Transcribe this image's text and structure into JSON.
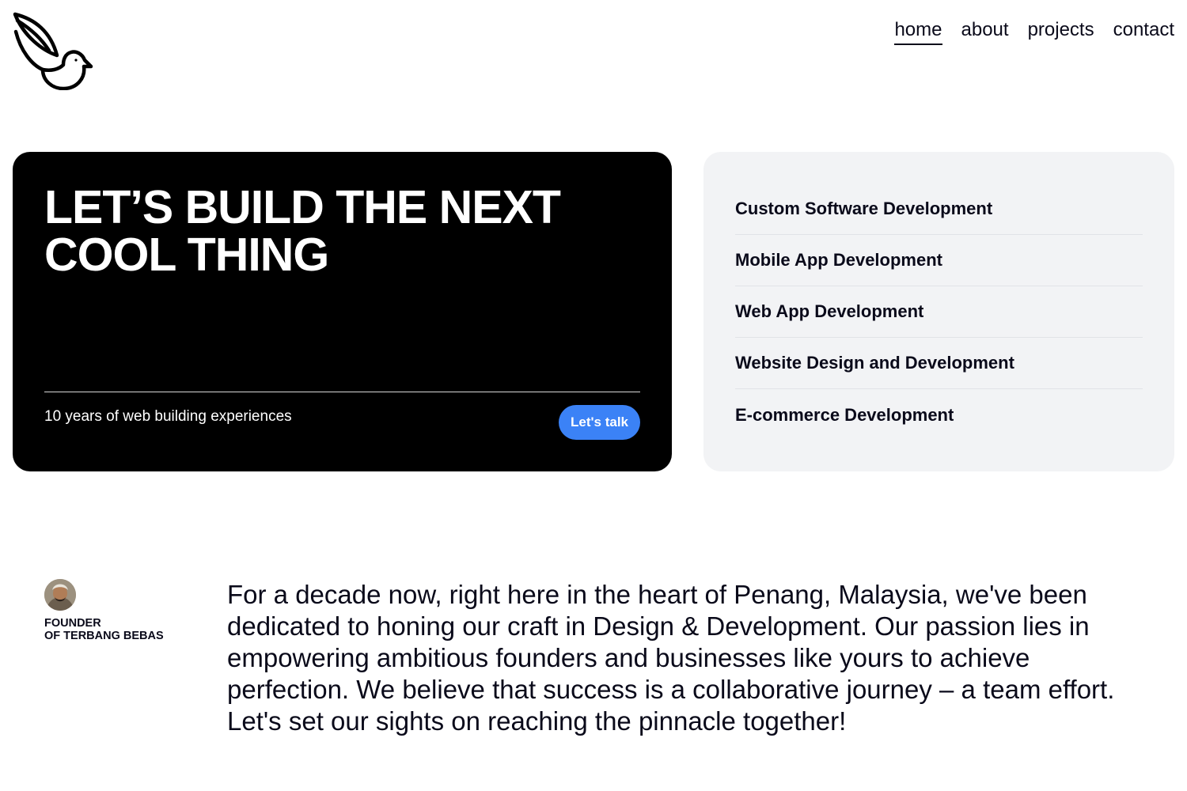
{
  "nav": {
    "items": [
      {
        "label": "home",
        "active": true
      },
      {
        "label": "about",
        "active": false
      },
      {
        "label": "projects",
        "active": false
      },
      {
        "label": "contact",
        "active": false
      }
    ]
  },
  "logo": {
    "icon": "bird-icon"
  },
  "hero": {
    "title": "LET’S BUILD THE NEXT COOL THING",
    "subtitle": "10 years of web building experiences",
    "cta_label": "Let's talk",
    "cta_color": "#3b82f6"
  },
  "services": {
    "items": [
      "Custom Software Development",
      "Mobile App Development",
      "Web App Development",
      "Website Design and Development",
      "E-commerce Development"
    ]
  },
  "founder": {
    "avatar_icon": "founder-avatar",
    "role_line1": "FOUNDER",
    "role_line2": "OF TERBANG BEBAS"
  },
  "statement": "For a decade now, right here in the heart of Penang, Malaysia, we've been dedicated to honing our craft in Design & Development. Our passion lies in empowering ambitious founders and businesses like yours to achieve perfection. We believe that success is a collaborative journey – a team effort. Let's set our sights on reaching the pinnacle together!"
}
